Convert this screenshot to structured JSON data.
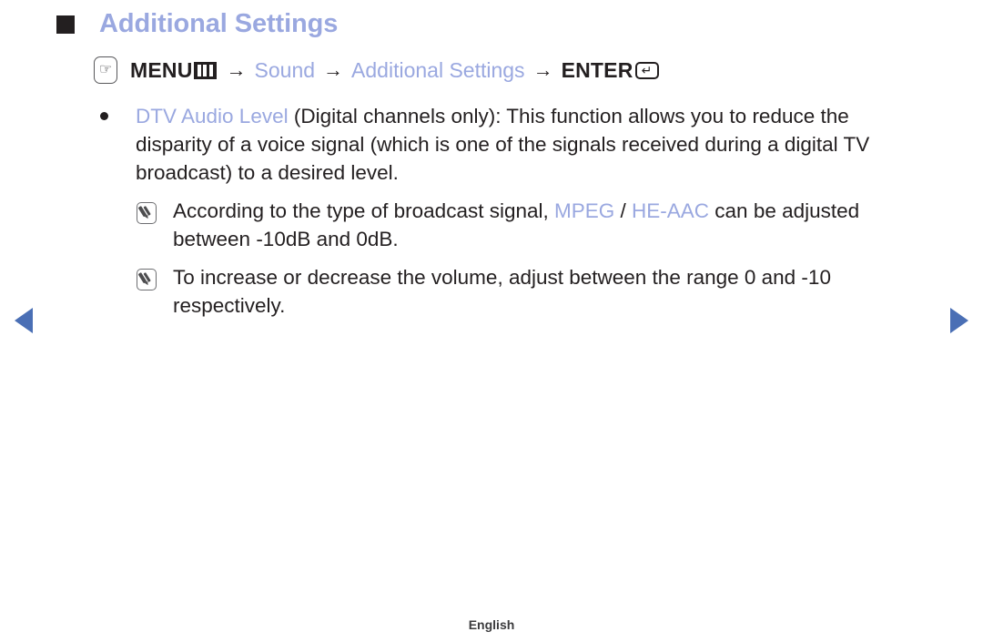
{
  "page": {
    "heading": "Additional Settings",
    "footer_language": "English"
  },
  "menu_path": {
    "press_icon": "press-hand-icon",
    "menu_label": "MENU",
    "keypad_icon": "menu-keypad-icon",
    "separator": "→",
    "step_sound": "Sound",
    "step_additional_settings": "Additional Settings",
    "enter_label": "ENTER",
    "enter_icon": "↵"
  },
  "content": {
    "bullet": {
      "marker": "●",
      "term": "DTV Audio Level",
      "body": " (Digital channels only): This function allows you to reduce the disparity of a voice signal (which is one of the signals received during a digital TV broadcast) to a desired level."
    },
    "notes": [
      {
        "icon": "note-pencil-icon",
        "prefix": "According to the type of broadcast signal, ",
        "term1": "MPEG",
        "separator": " / ",
        "term2": "HE-AAC",
        "suffix": " can be adjusted between -10dB and 0dB."
      },
      {
        "icon": "note-pencil-icon",
        "text": "To increase or decrease the volume, adjust between the range 0 and -10 respectively."
      }
    ]
  },
  "navigation": {
    "prev_label": "previous-page-arrow",
    "next_label": "next-page-arrow"
  },
  "colors": {
    "accent_blue": "#9aa8e0",
    "arrow_blue": "#4a6fb5",
    "text_dark": "#231f20"
  }
}
